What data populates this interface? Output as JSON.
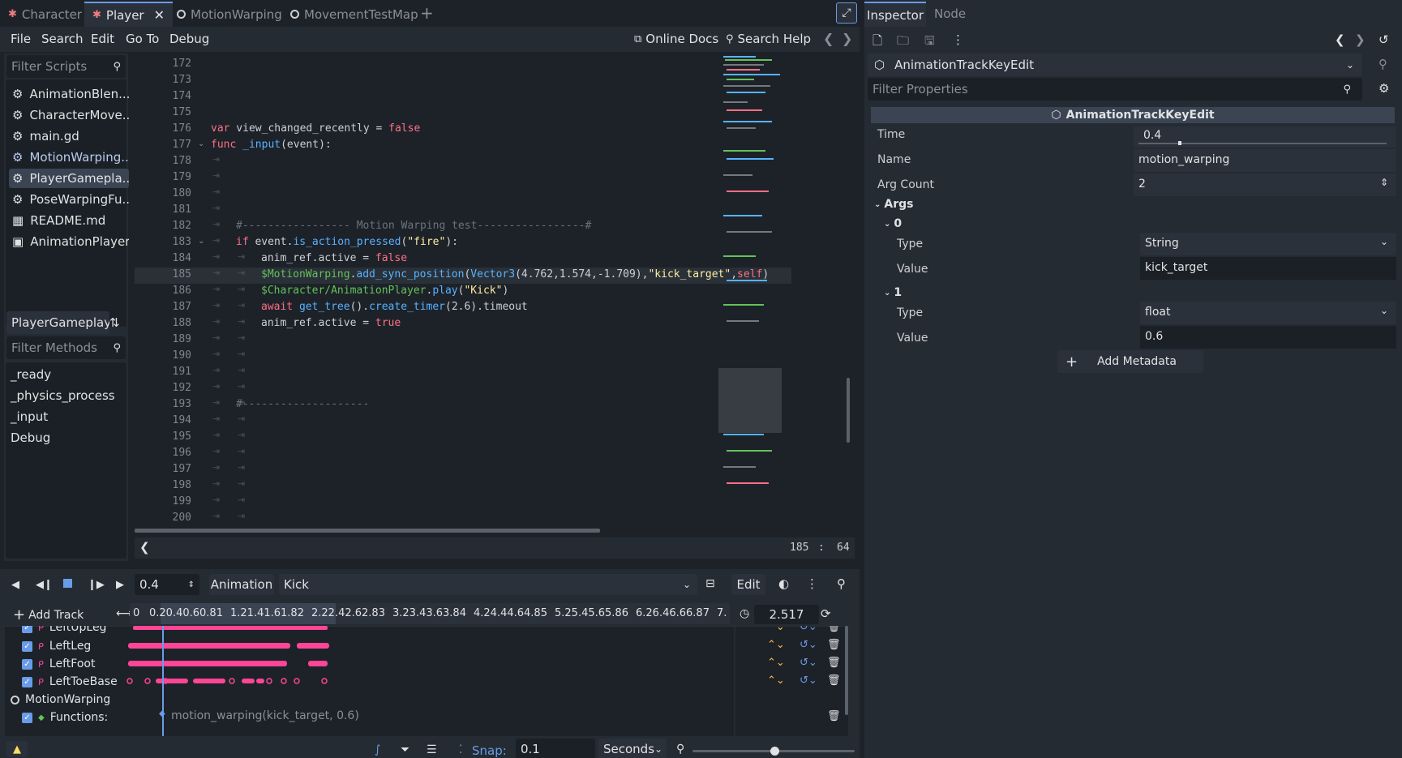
{
  "tabs": [
    {
      "label": "Character",
      "icon": "character-icon"
    },
    {
      "label": "Player",
      "icon": "character-icon",
      "active": true
    },
    {
      "label": "MotionWarping",
      "icon": "node-ring-icon"
    },
    {
      "label": "MovementTestMap",
      "icon": "node-ring-icon"
    }
  ],
  "menu": {
    "file": "File",
    "search": "Search",
    "edit": "Edit",
    "goto": "Go To",
    "debug": "Debug",
    "online_docs": "Online Docs",
    "search_help": "Search Help"
  },
  "scripts": {
    "filter_placeholder": "Filter Scripts",
    "items": [
      "AnimationBlen...",
      "CharacterMove...",
      "main.gd",
      "MotionWarping...",
      "PlayerGamepla...",
      "PoseWarpingFu...",
      "README.md",
      "AnimationPlayer"
    ],
    "current_script": "PlayerGameplay.c"
  },
  "methods": {
    "filter_placeholder": "Filter Methods",
    "items": [
      "_ready",
      "_physics_process",
      "_input",
      "Debug"
    ]
  },
  "editor": {
    "line_numbers": [
      "172",
      "173",
      "174",
      "175",
      "176",
      "177",
      "178",
      "179",
      "180",
      "181",
      "182",
      "183",
      "184",
      "185",
      "186",
      "187",
      "188",
      "189",
      "190",
      "191",
      "192",
      "193",
      "194",
      "195",
      "196",
      "197",
      "198",
      "199",
      "200"
    ],
    "lines": {
      "l176": {
        "kw": "var",
        "rest": " view_changed_recently = ",
        "val": "false"
      },
      "l177": {
        "kw": "func",
        "fn": " _input",
        "rest": "(event):"
      },
      "l182": "#----------------- Motion Warping test-----------------#",
      "l183": {
        "kw": "if",
        "rest1": " event.",
        "fn": "is_action_pressed",
        "rest2": "(",
        "str": "\"fire\"",
        "rest3": "):"
      },
      "l184": {
        "rest": "anim_ref.active = ",
        "val": "false"
      },
      "l185": {
        "node": "$MotionWarping",
        "rest1": ".",
        "fn": "add_sync_position",
        "rest2": "(",
        "fn2": "Vector3",
        "rest3": "(4.762,1.574,-1.709),",
        "str": "\"kick_target\"",
        "rest4": ",",
        "kw": "self",
        "rest5": ")"
      },
      "l186": {
        "node": "$Character/AnimationPlayer",
        "rest1": ".",
        "fn": "play",
        "rest2": "(",
        "str": "\"Kick\"",
        "rest3": ")"
      },
      "l187": {
        "kw": "await",
        "fn": " get_tree",
        "rest1": "().",
        "fn2": "create_timer",
        "rest2": "(2.6).timeout"
      },
      "l188": {
        "rest": "anim_ref.active = ",
        "val": "true"
      },
      "l193": "#--------------------"
    },
    "cursor_line": "185",
    "cursor_sep": ":",
    "cursor_col": "64"
  },
  "animation": {
    "time": "0.4",
    "animation_label": "Animation",
    "current_animation": "Kick",
    "edit_label": "Edit",
    "add_track": "Add Track",
    "ruler_labels": [
      "0",
      "0.20.40.60.81",
      "1.21.41.61.82",
      "2.22.42.62.83",
      "3.23.43.63.84",
      "4.24.44.64.85",
      "5.25.45.65.86",
      "6.26.46.66.87",
      "7."
    ],
    "length": "2.517",
    "tracks": [
      "LeftUpLeg",
      "LeftLeg",
      "LeftFoot",
      "LeftToeBase"
    ],
    "motion_warping": "MotionWarping",
    "functions_label": "Functions:",
    "function_key": "motion_warping(kick_target, 0.6)",
    "snap_label": "Snap:",
    "snap_value": "0.1",
    "snap_unit": "Seconds"
  },
  "inspector": {
    "tab_inspector": "Inspector",
    "tab_node": "Node",
    "object_name": "AnimationTrackKeyEdit",
    "filter_placeholder": "Filter Properties",
    "header": "AnimationTrackKeyEdit",
    "time_label": "Time",
    "time_value": "0.4",
    "time_fraction": 0.16,
    "name_label": "Name",
    "name_value": "motion_warping",
    "argcount_label": "Arg Count",
    "argcount_value": "2",
    "args_label": "Args",
    "arg0_label": "0",
    "arg0_type_label": "Type",
    "arg0_type": "String",
    "arg0_value_label": "Value",
    "arg0_value": "kick_target",
    "arg1_label": "1",
    "arg1_type_label": "Type",
    "arg1_type": "float",
    "arg1_value_label": "Value",
    "arg1_value": "0.6",
    "add_metadata": "Add Metadata"
  },
  "colors": {
    "accent": "#699ce8",
    "track_key": "#ff4596",
    "keyword": "#ff7085",
    "function": "#57b3ff",
    "string": "#ffeda1"
  }
}
